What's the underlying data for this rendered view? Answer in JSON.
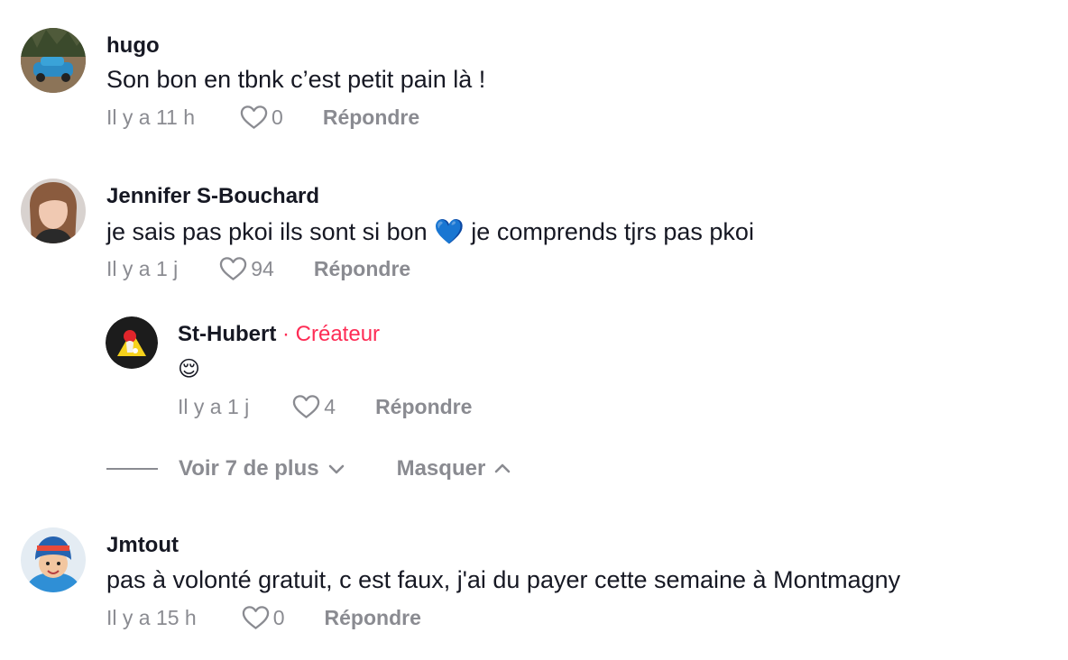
{
  "comments": [
    {
      "username": "hugo",
      "text": "Son bon en tbnk c’est petit pain là !",
      "time": "Il y a 11 h",
      "likes": "0",
      "reply_label": "Répondre"
    },
    {
      "username": "Jennifer S-Bouchard",
      "text": "je sais pas pkoi ils sont si bon 💙 je comprends tjrs pas pkoi",
      "time": "Il y a 1 j",
      "likes": "94",
      "reply_label": "Répondre"
    },
    {
      "username": "St-Hubert",
      "creator_tag": "· Créateur",
      "text": "😌",
      "time": "Il y a 1 j",
      "likes": "4",
      "reply_label": "Répondre"
    },
    {
      "username": "Jmtout",
      "text": "pas à volonté gratuit, c est faux, j'ai du payer cette semaine à Montmagny",
      "time": "Il y a 15 h",
      "likes": "0",
      "reply_label": "Répondre"
    }
  ],
  "thread_controls": {
    "view_more": "Voir 7 de plus",
    "hide": "Masquer"
  },
  "colors": {
    "text": "#161823",
    "muted": "#8a8b91",
    "creator": "#fe2c55"
  },
  "icons": {
    "like": "heart-outline-icon",
    "view_more": "chevron-down-icon",
    "hide": "chevron-up-icon"
  }
}
